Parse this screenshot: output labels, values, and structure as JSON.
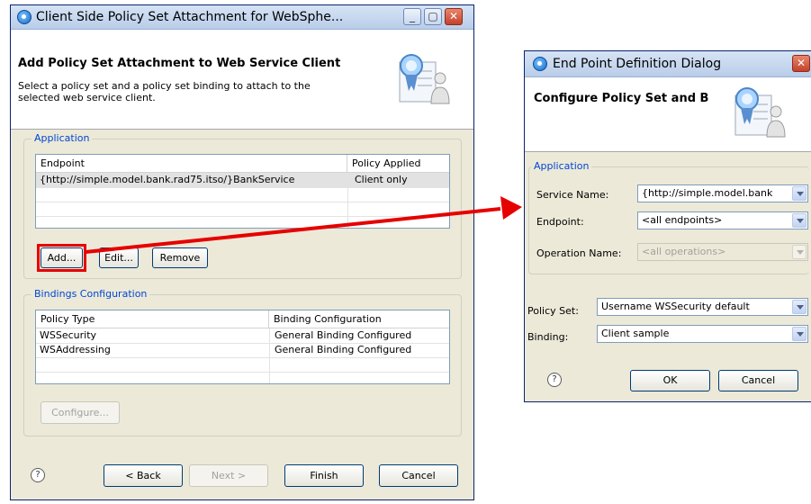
{
  "left_window": {
    "title": "Client Side Policy Set Attachment for WebSphe...",
    "banner_title": "Add Policy Set Attachment to Web Service Client",
    "banner_desc_line1": "Select a policy set and a policy set binding to attach to the",
    "banner_desc_line2": "selected web service client.",
    "application": {
      "legend": "Application",
      "columns": [
        "Endpoint",
        "Policy Applied"
      ],
      "rows": [
        {
          "endpoint": "{http://simple.model.bank.rad75.itso/}BankService",
          "policy": "Client only"
        }
      ],
      "add_label": "Add...",
      "edit_label": "Edit...",
      "remove_label": "Remove"
    },
    "bindings": {
      "legend": "Bindings Configuration",
      "columns": [
        "Policy Type",
        "Binding Configuration"
      ],
      "rows": [
        {
          "type": "WSSecurity",
          "binding": "General Binding Configured"
        },
        {
          "type": "WSAddressing",
          "binding": "General Binding Configured"
        }
      ],
      "configure_label": "Configure..."
    },
    "footer": {
      "help": "?",
      "back_label": "< Back",
      "next_label": "Next >",
      "finish_label": "Finish",
      "cancel_label": "Cancel"
    }
  },
  "right_window": {
    "title": "End Point Definition Dialog",
    "banner_title": "Configure Policy Set and B",
    "application": {
      "legend": "Application",
      "service_name_label": "Service Name:",
      "service_name_value": "{http://simple.model.bank",
      "endpoint_label": "Endpoint:",
      "endpoint_value": "<all endpoints>",
      "operation_label": "Operation Name:",
      "operation_value": "<all operations>"
    },
    "policy_set_label": "Policy Set:",
    "policy_set_value": "Username WSSecurity default",
    "binding_label": "Binding:",
    "binding_value": "Client sample",
    "help": "?",
    "ok_label": "OK",
    "cancel_label": "Cancel"
  },
  "colors": {
    "highlight": "#e60000",
    "arrow": "#e60000",
    "legend_text": "#0046d5"
  },
  "icons": [
    "app-icon",
    "minimize-icon",
    "maximize-icon",
    "close-icon",
    "ribbon-user-icon",
    "help-icon",
    "chevron-down-icon"
  ]
}
